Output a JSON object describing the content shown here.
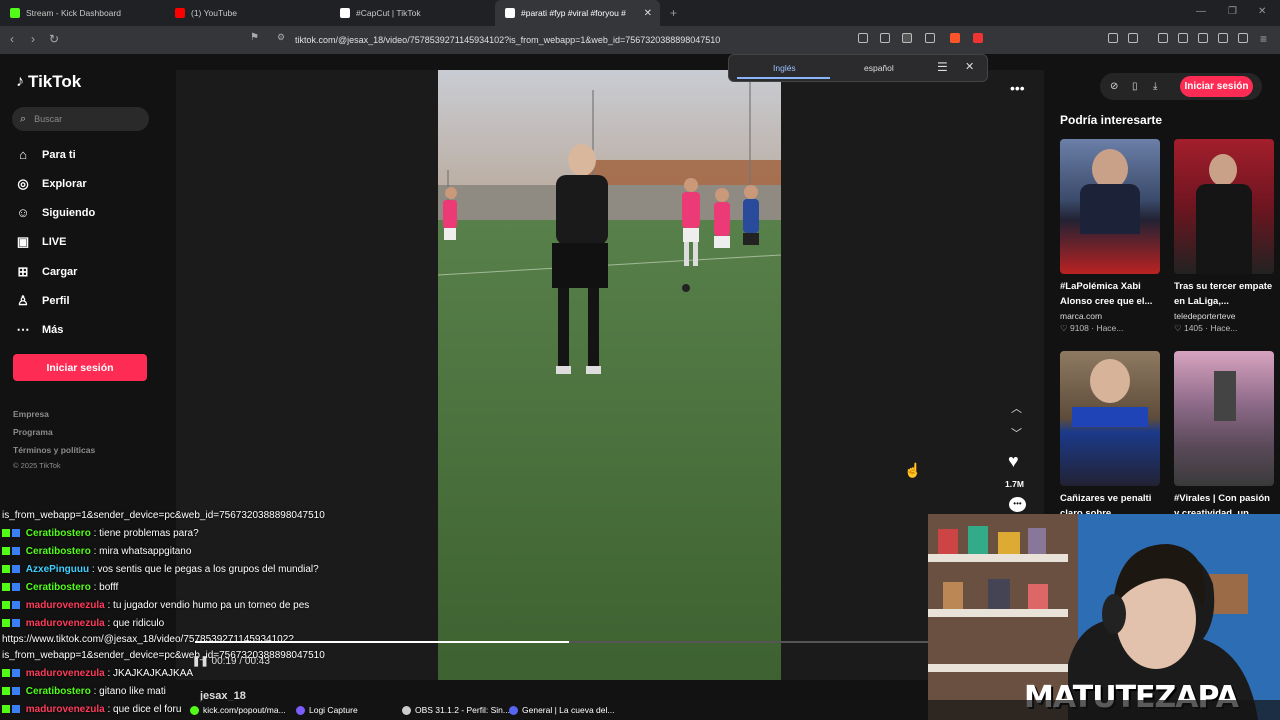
{
  "browser": {
    "tabs": [
      {
        "title": "Stream - Kick Dashboard",
        "favicon": "kick-icon",
        "color": "#53fc18"
      },
      {
        "title": "(1) YouTube",
        "favicon": "youtube-icon",
        "color": "#ff0000"
      },
      {
        "title": "#CapCut | TikTok",
        "favicon": "tiktok-icon",
        "color": "#ffffff"
      },
      {
        "title": "#parati #fyp #viral #foryou #",
        "favicon": "tiktok-icon",
        "color": "#ffffff"
      }
    ],
    "url": "tiktok.com/@jesax_18/video/7578539271145934102?is_from_webapp=1&web_id=7567320388898047510",
    "translate": {
      "source": "Inglés",
      "target": "español"
    }
  },
  "tiktok": {
    "logo": "TikTok",
    "search_placeholder": "Buscar",
    "nav": [
      {
        "label": "Para ti",
        "icon": "home-icon"
      },
      {
        "label": "Explorar",
        "icon": "compass-icon"
      },
      {
        "label": "Siguiendo",
        "icon": "following-icon"
      },
      {
        "label": "LIVE",
        "icon": "live-icon"
      },
      {
        "label": "Cargar",
        "icon": "upload-icon"
      },
      {
        "label": "Perfil",
        "icon": "profile-icon"
      },
      {
        "label": "Más",
        "icon": "more-icon"
      }
    ],
    "login_label": "Iniciar sesión",
    "footer": [
      "Empresa",
      "Programa",
      "Términos y políticas"
    ],
    "copyright": "© 2025 TikTok",
    "like_count": "1.7M",
    "author": "jesax_18",
    "time": "00:19 / 00:43",
    "progress": 0.51,
    "recommended_title": "Podría interesarte",
    "recommended": [
      {
        "title": "#LaPolémica Xabi Alonso cree que el...",
        "source": "marca.com",
        "meta": "♡ 9108 · Hace..."
      },
      {
        "title": "Tras su tercer empate en LaLiga,...",
        "source": "teledeporterteve",
        "meta": "♡ 1405 · Hace..."
      },
      {
        "title": "Cañizares ve penalti claro sobre",
        "source": "",
        "meta": ""
      },
      {
        "title": "#Virales | Con pasión y creatividad, un",
        "source": "",
        "meta": ""
      }
    ]
  },
  "chat": [
    {
      "user": "",
      "text": "is_from_webapp=1&sender_device=pc&web_id=7567320388898047510",
      "color": "#ffffff"
    },
    {
      "user": "Ceratibostero",
      "text": ": tiene problemas para?",
      "color": "#53fc18"
    },
    {
      "user": "Ceratibostero",
      "text": ": mira whatsappgitano",
      "color": "#53fc18"
    },
    {
      "user": "AzxePinguuu",
      "text": ": vos sentis que le pegas a los grupos del mundial?",
      "color": "#3fd0ff"
    },
    {
      "user": "Ceratibostero",
      "text": ": bofff",
      "color": "#53fc18"
    },
    {
      "user": "madurovenezula",
      "text": ": tu jugador vendio humo pa un torneo de pes",
      "color": "#ff3b5c"
    },
    {
      "user": "madurovenezula",
      "text": ": que ridiculo",
      "color": "#ff3b5c"
    },
    {
      "user": "",
      "text": "https://www.tiktok.com/@jesax_18/video/7578539271145934102?",
      "color": "#ffffff"
    },
    {
      "user": "",
      "text": "is_from_webapp=1&sender_device=pc&web_id=7567320388898047510",
      "color": "#ffffff"
    },
    {
      "user": "madurovenezula",
      "text": ": JKAJKAJKAJKAA",
      "color": "#ff3b5c"
    },
    {
      "user": "Ceratibostero",
      "text": ": gitano like mati",
      "color": "#53fc18"
    },
    {
      "user": "madurovenezula",
      "text": ": que dice el foru",
      "color": "#ff3b5c"
    }
  ],
  "webcam": {
    "name": "MATUTEZAPA"
  },
  "taskbar": [
    {
      "label": "kick.com/popout/ma...",
      "color": "#53fc18"
    },
    {
      "label": "Logi Capture",
      "color": "#7a5cff"
    },
    {
      "label": "OBS 31.1.2 - Perfil: Sin...",
      "color": "#cccccc"
    },
    {
      "label": "General | La cueva del...",
      "color": "#5865f2"
    }
  ]
}
